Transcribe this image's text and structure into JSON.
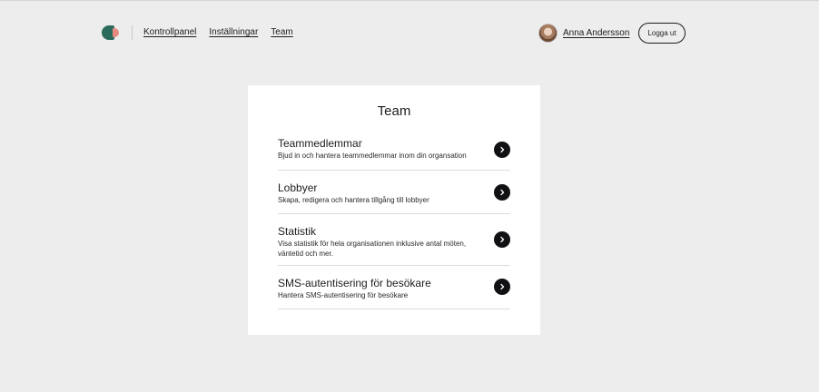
{
  "nav": {
    "items": [
      {
        "label": "Kontrollpanel"
      },
      {
        "label": "Inställningar"
      },
      {
        "label": "Team"
      }
    ]
  },
  "user": {
    "name": "Anna Andersson",
    "logout_label": "Logga ut"
  },
  "card": {
    "title": "Team",
    "items": [
      {
        "title": "Teammedlemmar",
        "description": "Bjud in och hantera teammedlemmar inom din organsation"
      },
      {
        "title": "Lobbyer",
        "description": "Skapa, redigera och hantera tillgång till lobbyer"
      },
      {
        "title": "Statistik",
        "description": "Visa statistik för hela organisationen inklusive antal möten, väntetid och mer."
      },
      {
        "title": "SMS-autentisering för besökare",
        "description": "Hantera SMS-autentisering för besökare"
      }
    ]
  },
  "colors": {
    "background": "#ededed",
    "logo_primary": "#2a6b5b",
    "logo_accent": "#e88a80",
    "arrow_button": "#111114"
  },
  "icons": {
    "arrow": "chevron-right-icon"
  }
}
